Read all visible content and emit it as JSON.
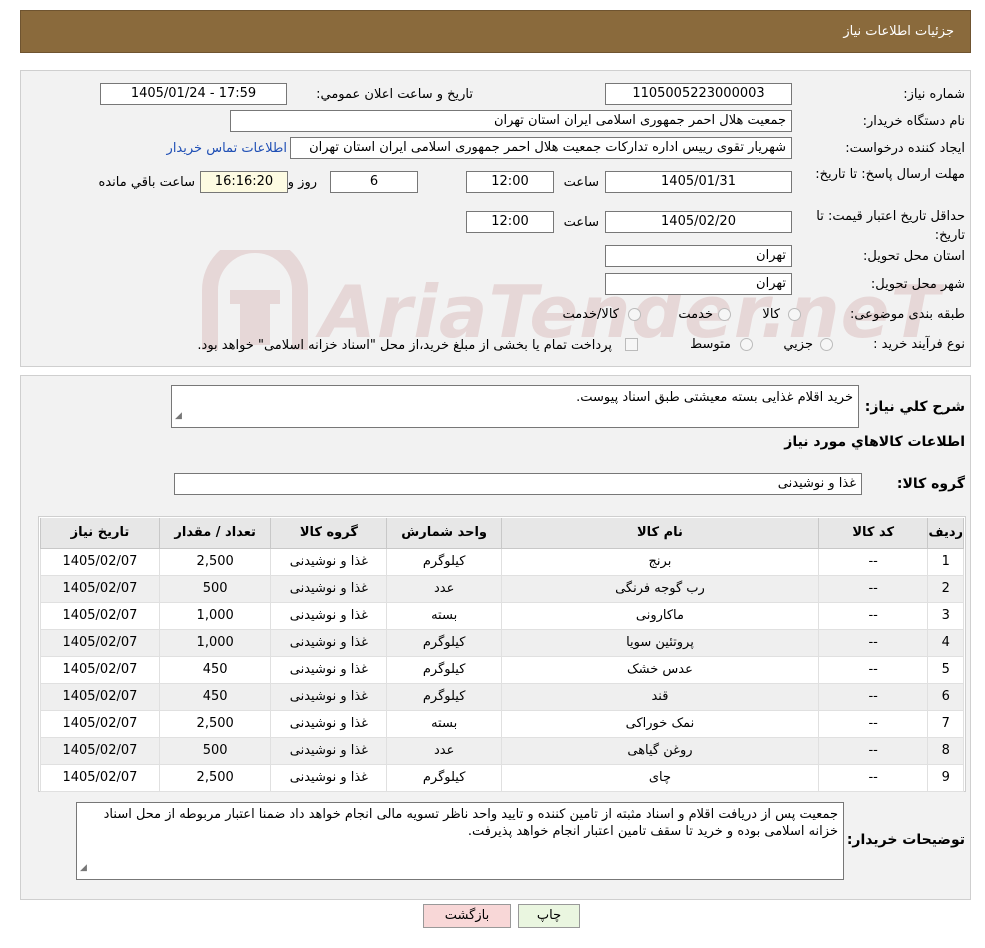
{
  "header": {
    "title": "جزئیات اطلاعات نیاز"
  },
  "form": {
    "need_number_label": "شماره نیاز:",
    "need_number": "1105005223000003",
    "announce_label": "تاریخ و ساعت اعلان عمومي:",
    "announce_value": "1405/01/24 - 17:59",
    "buyer_org_label": "نام دستگاه خریدار:",
    "buyer_org": "جمعیت هلال احمر جمهوری اسلامی ایران استان تهران",
    "creator_label": "ایجاد کننده درخواست:",
    "creator": "شهریار تقوی رییس اداره تدارکات جمعیت هلال احمر جمهوری اسلامی ایران استان تهران",
    "contact_link": "اطلاعات تماس خریدار",
    "deadline_label": "مهلت ارسال پاسخ: تا تاریخ:",
    "deadline_date": "1405/01/31",
    "time_label": "ساعت",
    "deadline_time": "12:00",
    "days_value": "6",
    "days_label": "روز و",
    "remaining_time": "16:16:20",
    "remaining_label": "ساعت باقي مانده",
    "validity_label": "حداقل تاریخ اعتبار قیمت: تا تاریخ:",
    "validity_date": "1405/02/20",
    "validity_time": "12:00",
    "province_label": "استان محل تحویل:",
    "province": "تهران",
    "city_label": "شهر محل تحویل:",
    "city": "تهران",
    "category_label": "طبقه بندی موضوعی:",
    "category_options": [
      "کالا",
      "خدمت",
      "کالا/خدمت"
    ],
    "process_label": "نوع فرآیند خرید :",
    "process_options": [
      "جزيي",
      "متوسط"
    ],
    "payment_note": "پرداخت تمام یا بخشی از مبلغ خرید،از محل \"اسناد خزانه اسلامی\" خواهد بود."
  },
  "watermark": {
    "text": "AriaTender.neT"
  },
  "details": {
    "summary_label": "شرح کلي نیاز:",
    "summary": "خرید اقلام غذایی بسته معیشتی طبق اسناد پیوست.",
    "items_heading": "اطلاعات کالاهاي مورد نیاز",
    "group_label": "گروه کالا:",
    "group_value": "غذا و نوشیدنی"
  },
  "table": {
    "headers": [
      "ردیف",
      "کد کالا",
      "نام کالا",
      "واحد شمارش",
      "گروه کالا",
      "تعداد / مقدار",
      "تاریخ نیاز"
    ],
    "rows": [
      [
        "1",
        "--",
        "برنج",
        "کیلوگرم",
        "غذا و نوشیدنی",
        "2,500",
        "1405/02/07"
      ],
      [
        "2",
        "--",
        "رب گوجه فرنگی",
        "عدد",
        "غذا و نوشیدنی",
        "500",
        "1405/02/07"
      ],
      [
        "3",
        "--",
        "ماکارونی",
        "بسته",
        "غذا و نوشیدنی",
        "1,000",
        "1405/02/07"
      ],
      [
        "4",
        "--",
        "پروتئین سویا",
        "کیلوگرم",
        "غذا و نوشیدنی",
        "1,000",
        "1405/02/07"
      ],
      [
        "5",
        "--",
        "عدس خشک",
        "کیلوگرم",
        "غذا و نوشیدنی",
        "450",
        "1405/02/07"
      ],
      [
        "6",
        "--",
        "قند",
        "کیلوگرم",
        "غذا و نوشیدنی",
        "450",
        "1405/02/07"
      ],
      [
        "7",
        "--",
        "نمک خوراکی",
        "بسته",
        "غذا و نوشیدنی",
        "2,500",
        "1405/02/07"
      ],
      [
        "8",
        "--",
        "روغن گیاهی",
        "عدد",
        "غذا و نوشیدنی",
        "500",
        "1405/02/07"
      ],
      [
        "9",
        "--",
        "چای",
        "کیلوگرم",
        "غذا و نوشیدنی",
        "2,500",
        "1405/02/07"
      ]
    ]
  },
  "buyer_notes": {
    "label": "توضیحات خریدار:",
    "text": "جمعیت پس از دریافت اقلام و اسناد مثبته از تامین کننده و تایید واحد ناظر تسویه مالی انجام خواهد داد ضمنا اعتبار مربوطه از محل اسناد خزانه اسلامی بوده و خرید تا سقف تامین اعتبار انجام خواهد پذیرفت."
  },
  "buttons": {
    "print": "چاپ",
    "back": "بازگشت"
  }
}
